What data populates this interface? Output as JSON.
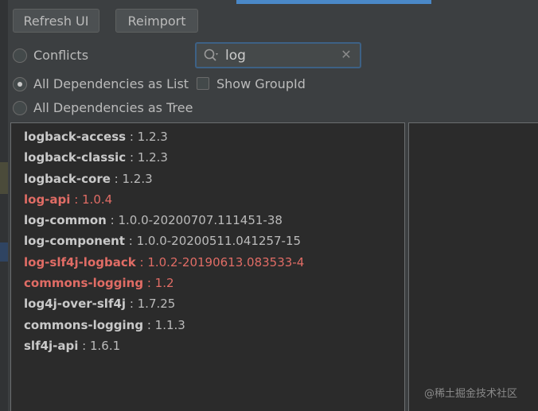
{
  "toolbar": {
    "refresh_label": "Refresh UI",
    "reimport_label": "Reimport"
  },
  "view_options": {
    "conflicts_label": "Conflicts",
    "list_label": "All Dependencies as List",
    "tree_label": "All Dependencies as Tree",
    "selected": "list",
    "show_groupid_label": "Show GroupId",
    "show_groupid_checked": false
  },
  "search": {
    "value": "log",
    "search_icon": "search-icon",
    "clear_icon": "close-icon"
  },
  "dependencies": [
    {
      "name": "logback-access",
      "version": "1.2.3",
      "conflict": false
    },
    {
      "name": "logback-classic",
      "version": "1.2.3",
      "conflict": false
    },
    {
      "name": "logback-core",
      "version": "1.2.3",
      "conflict": false
    },
    {
      "name": "log-api",
      "version": "1.0.4",
      "conflict": true
    },
    {
      "name": "log-common",
      "version": "1.0.0-20200707.111451-38",
      "conflict": false
    },
    {
      "name": "log-component",
      "version": "1.0.0-20200511.041257-15",
      "conflict": false
    },
    {
      "name": "log-slf4j-logback",
      "version": "1.0.2-20190613.083533-4",
      "conflict": true
    },
    {
      "name": "commons-logging",
      "version": "1.2",
      "conflict": true
    },
    {
      "name": "log4j-over-slf4j",
      "version": "1.7.25",
      "conflict": false
    },
    {
      "name": "commons-logging",
      "version": "1.1.3",
      "conflict": false
    },
    {
      "name": "slf4j-api",
      "version": "1.6.1",
      "conflict": false
    }
  ],
  "separator": " : ",
  "watermark": "@稀土掘金技术社区",
  "colors": {
    "conflict": "#e06c65",
    "accent": "#4a88c7"
  }
}
